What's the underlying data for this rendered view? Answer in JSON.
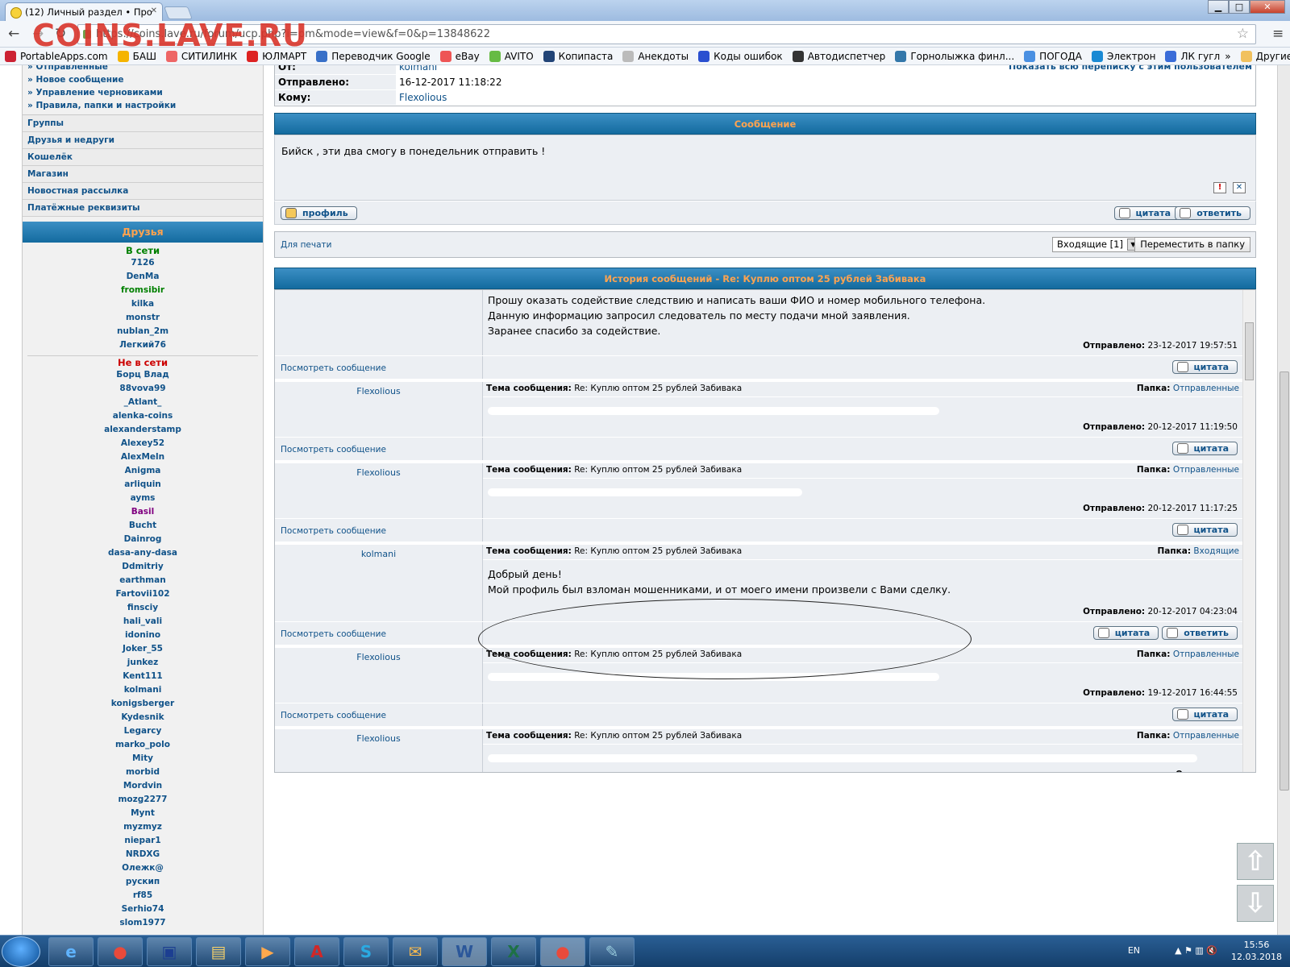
{
  "browser": {
    "tab_title": "(12) Личный раздел • Про",
    "url": "https://coins.lave.ru/forum/ucp.php?i=pm&mode=view&f=0&p=13848622",
    "watermark": "COINS.LAVE.RU"
  },
  "bookmarks": [
    "PortableApps.com",
    "БАШ",
    "СИТИЛИНК",
    "ЮЛМАРТ",
    "Переводчик Google",
    "eBay",
    "AVITO",
    "Копипаста",
    "Анекдоты",
    "Коды ошибок",
    "Автодиспетчер",
    "Горнолыжка финл...",
    "ПОГОДА",
    "Электрон",
    "ЛК гугл",
    "»",
    "Другие закладки"
  ],
  "sidebar": {
    "links": [
      "» Отправленные",
      "» Новое сообщение",
      "» Управление черновиками",
      "» Правила, папки и настройки"
    ],
    "items": [
      "Группы",
      "Друзья и недруги",
      "Кошелёк",
      "Магазин",
      "Новостная рассылка",
      "Платёжные реквизиты"
    ],
    "friends_title": "Друзья",
    "online_label": "В сети",
    "online": [
      "7126",
      "DenMa",
      "fromsibir",
      "kilka",
      "monstr",
      "nublan_2m",
      "Легкий76"
    ],
    "offline_label": "Не в сети",
    "offline": [
      "Борц Влад",
      "88vova99",
      "_Atlant_",
      "alenka-coins",
      "alexanderstamp",
      "Alexey52",
      "AlexMeln",
      "Anigma",
      "arliquin",
      "ayms",
      "Basil",
      "Bucht",
      "Dainrog",
      "dasa-any-dasa",
      "Ddmitriy",
      "earthman",
      "Fartovii102",
      "finsciy",
      "hali_vali",
      "idonino",
      "Joker_55",
      "junkez",
      "Kent111",
      "kolmani",
      "konigsberger",
      "Kydesnik",
      "Legarcy",
      "marko_polo",
      "Mity",
      "morbid",
      "Mordvin",
      "mozg2277",
      "Mynt",
      "myzmyz",
      "niepar1",
      "NRDXG",
      "Олежк@",
      "рускип",
      "rf85",
      "Serhio74",
      "slom1977"
    ]
  },
  "message": {
    "from_label": "От:",
    "from_value": "kolmani",
    "show_all": "Показать всю переписку с этим пользователем",
    "sent_label": "Отправлено:",
    "sent_value": "16-12-2017 11:18:22",
    "to_label": "Кому:",
    "to_value": "Flexolious",
    "header": "Сообщение",
    "body": "Бийск , эти два смогу в понедельник отправить !",
    "profile_btn": "профиль",
    "quote_btn": "цитата",
    "reply_btn": "ответить",
    "print_link": "Для печати",
    "folder_select": "Входящие [1]",
    "move_btn": "Переместить в папку"
  },
  "history": {
    "title": "История сообщений - Re: Куплю оптом 25 рублей Забивака",
    "subj_label": "Тема сообщения:",
    "subj_value": "Re: Куплю оптом 25 рублей Забивака",
    "folder_label": "Папка:",
    "sent_label": "Отправлено:",
    "view_link": "Посмотреть сообщение",
    "quote_btn": "цитата",
    "reply_btn": "ответить",
    "first": {
      "lines": [
        "Прошу оказать содействие следствию и написать ваши ФИО и номер мобильного телефона.",
        "Данную информацию запросил следователь по месту подачи мной заявления.",
        "Заранее спасибо за содействие."
      ],
      "sent": "23-12-2017 19:57:51"
    },
    "entries": [
      {
        "author": "Flexolious",
        "folder": "Отправленные",
        "body": "",
        "sent": "20-12-2017 11:19:50"
      },
      {
        "author": "Flexolious",
        "folder": "Отправленные",
        "body": "",
        "sent": "20-12-2017 11:17:25"
      },
      {
        "author": "kolmani",
        "folder": "Входящие",
        "body": "Добрый день!",
        "body2": "Мой профиль был взломан мошенниками, и от моего имени произвели с Вами сделку.",
        "sent": "20-12-2017 04:23:04"
      },
      {
        "author": "Flexolious",
        "folder": "Отправленные",
        "body": "",
        "sent": "19-12-2017 16:44:55"
      },
      {
        "author": "Flexolious",
        "folder": "Отправленные",
        "body": "",
        "sent": ""
      }
    ]
  },
  "taskbar": {
    "lang": "EN",
    "time": "15:56",
    "date": "12.03.2018"
  }
}
